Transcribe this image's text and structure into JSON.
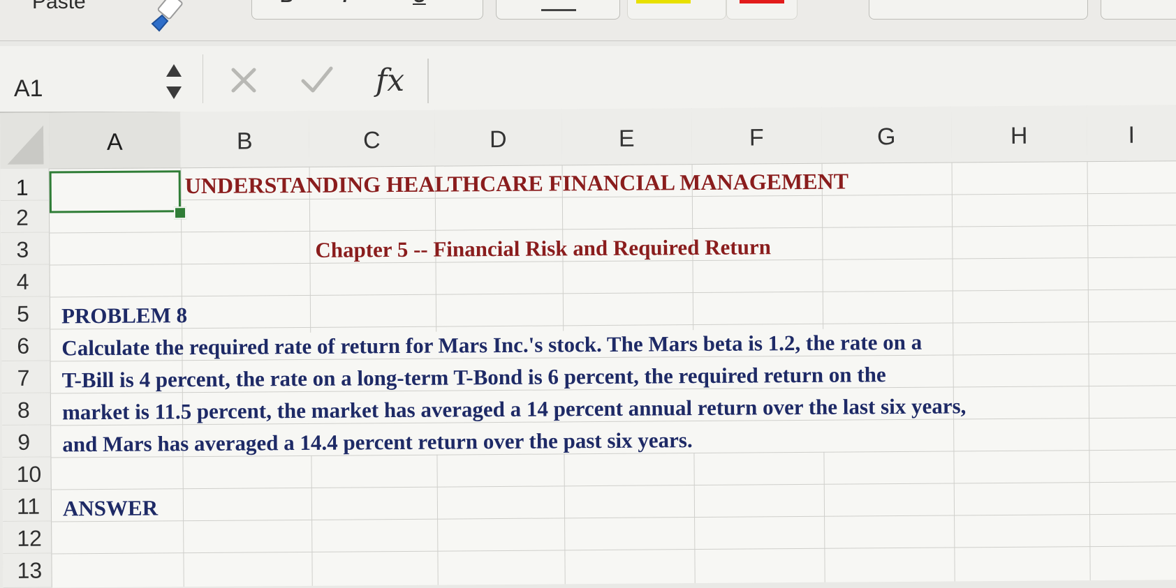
{
  "ribbon": {
    "paste_label": "Paste",
    "format_buttons": [
      "B",
      "I",
      "U"
    ],
    "swatch_colors": {
      "highlight": "#e8e000",
      "font_color": "#e21b1b"
    }
  },
  "formula_bar": {
    "name_box": "A1",
    "fx_label": "fx",
    "formula_value": ""
  },
  "sheet": {
    "columns": [
      "A",
      "B",
      "C",
      "D",
      "E",
      "F",
      "G",
      "H",
      "I"
    ],
    "rows": [
      "1",
      "2",
      "3",
      "4",
      "5",
      "6",
      "7",
      "8",
      "9",
      "10",
      "11",
      "12",
      "13"
    ],
    "selected_cell": "A1",
    "cells": {
      "B1": "UNDERSTANDING HEALTHCARE FINANCIAL MANAGEMENT",
      "C3": "Chapter 5 -- Financial Risk and Required Return",
      "A5": "PROBLEM 8",
      "A6": "Calculate the required rate of return for Mars Inc.'s stock.  The Mars beta is 1.2, the rate on a",
      "A7": "T-Bill is 4 percent, the rate on a long-term T-Bond is 6 percent, the required return on the",
      "A8": "market is 11.5 percent, the market has averaged a 14 percent annual return over the last six years,",
      "A9": "and Mars has averaged a 14.4 percent return over the past six years.",
      "A11": "ANSWER"
    }
  },
  "colors": {
    "title_red": "#8a1d1d",
    "body_blue": "#1e2a66",
    "selection_green": "#2f7d36"
  }
}
